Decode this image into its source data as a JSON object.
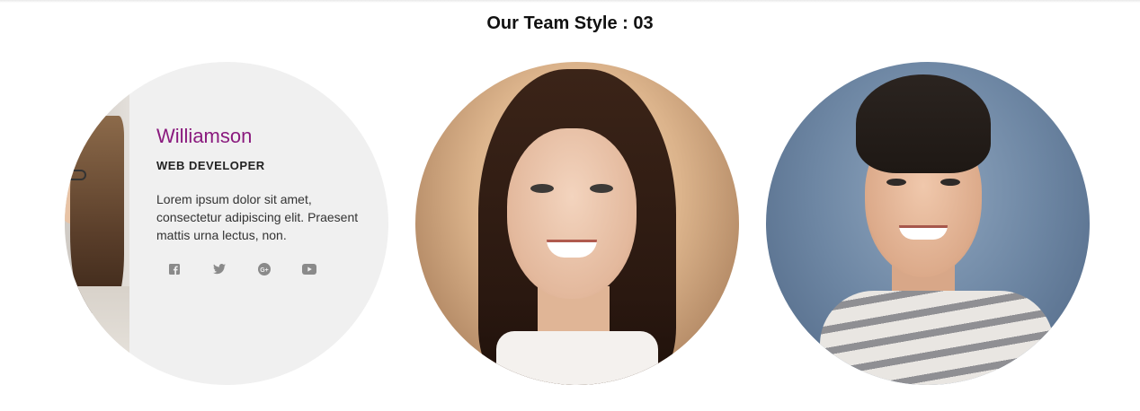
{
  "section": {
    "title": "Our Team Style : 03"
  },
  "members": [
    {
      "name": "Williamson",
      "role": "WEB DEVELOPER",
      "description": "Lorem ipsum dolor sit amet, consectetur adipiscing elit. Praesent mattis urna lectus, non.",
      "socials": [
        "facebook-icon",
        "twitter-icon",
        "google-plus-icon",
        "youtube-icon"
      ]
    },
    {
      "photo": "woman-portrait"
    },
    {
      "photo": "man-portrait"
    }
  ],
  "colors": {
    "name_accent": "#8a1a7e",
    "card_bg": "#f0f0f0",
    "icon": "#8a8a8a"
  }
}
